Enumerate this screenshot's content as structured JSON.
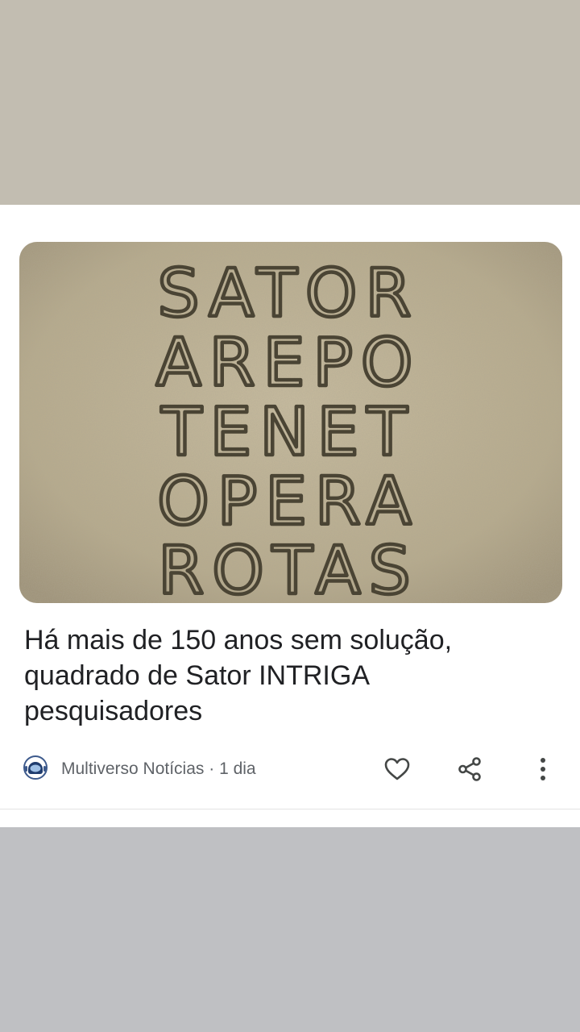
{
  "feed": {
    "card": {
      "thumbnail": {
        "rows": [
          "SATOR",
          "AREPO",
          "TENET",
          "OPERA",
          "ROTAS"
        ]
      },
      "headline": "Há mais de 150 anos sem solução, quadrado de Sator INTRIGA pesquisadores",
      "source": "Multiverso Notícias",
      "separator": " · ",
      "age": "1 dia",
      "icons": {
        "source_logo": "astronaut-helmet-icon",
        "like": "heart-outline-icon",
        "share": "share-icon",
        "more": "more-vertical-icon"
      }
    }
  },
  "colors": {
    "top_band": "#c2bdb1",
    "bottom_band": "#bfc0c3",
    "headline": "#202124",
    "meta": "#5f6368",
    "icon": "#444746"
  }
}
